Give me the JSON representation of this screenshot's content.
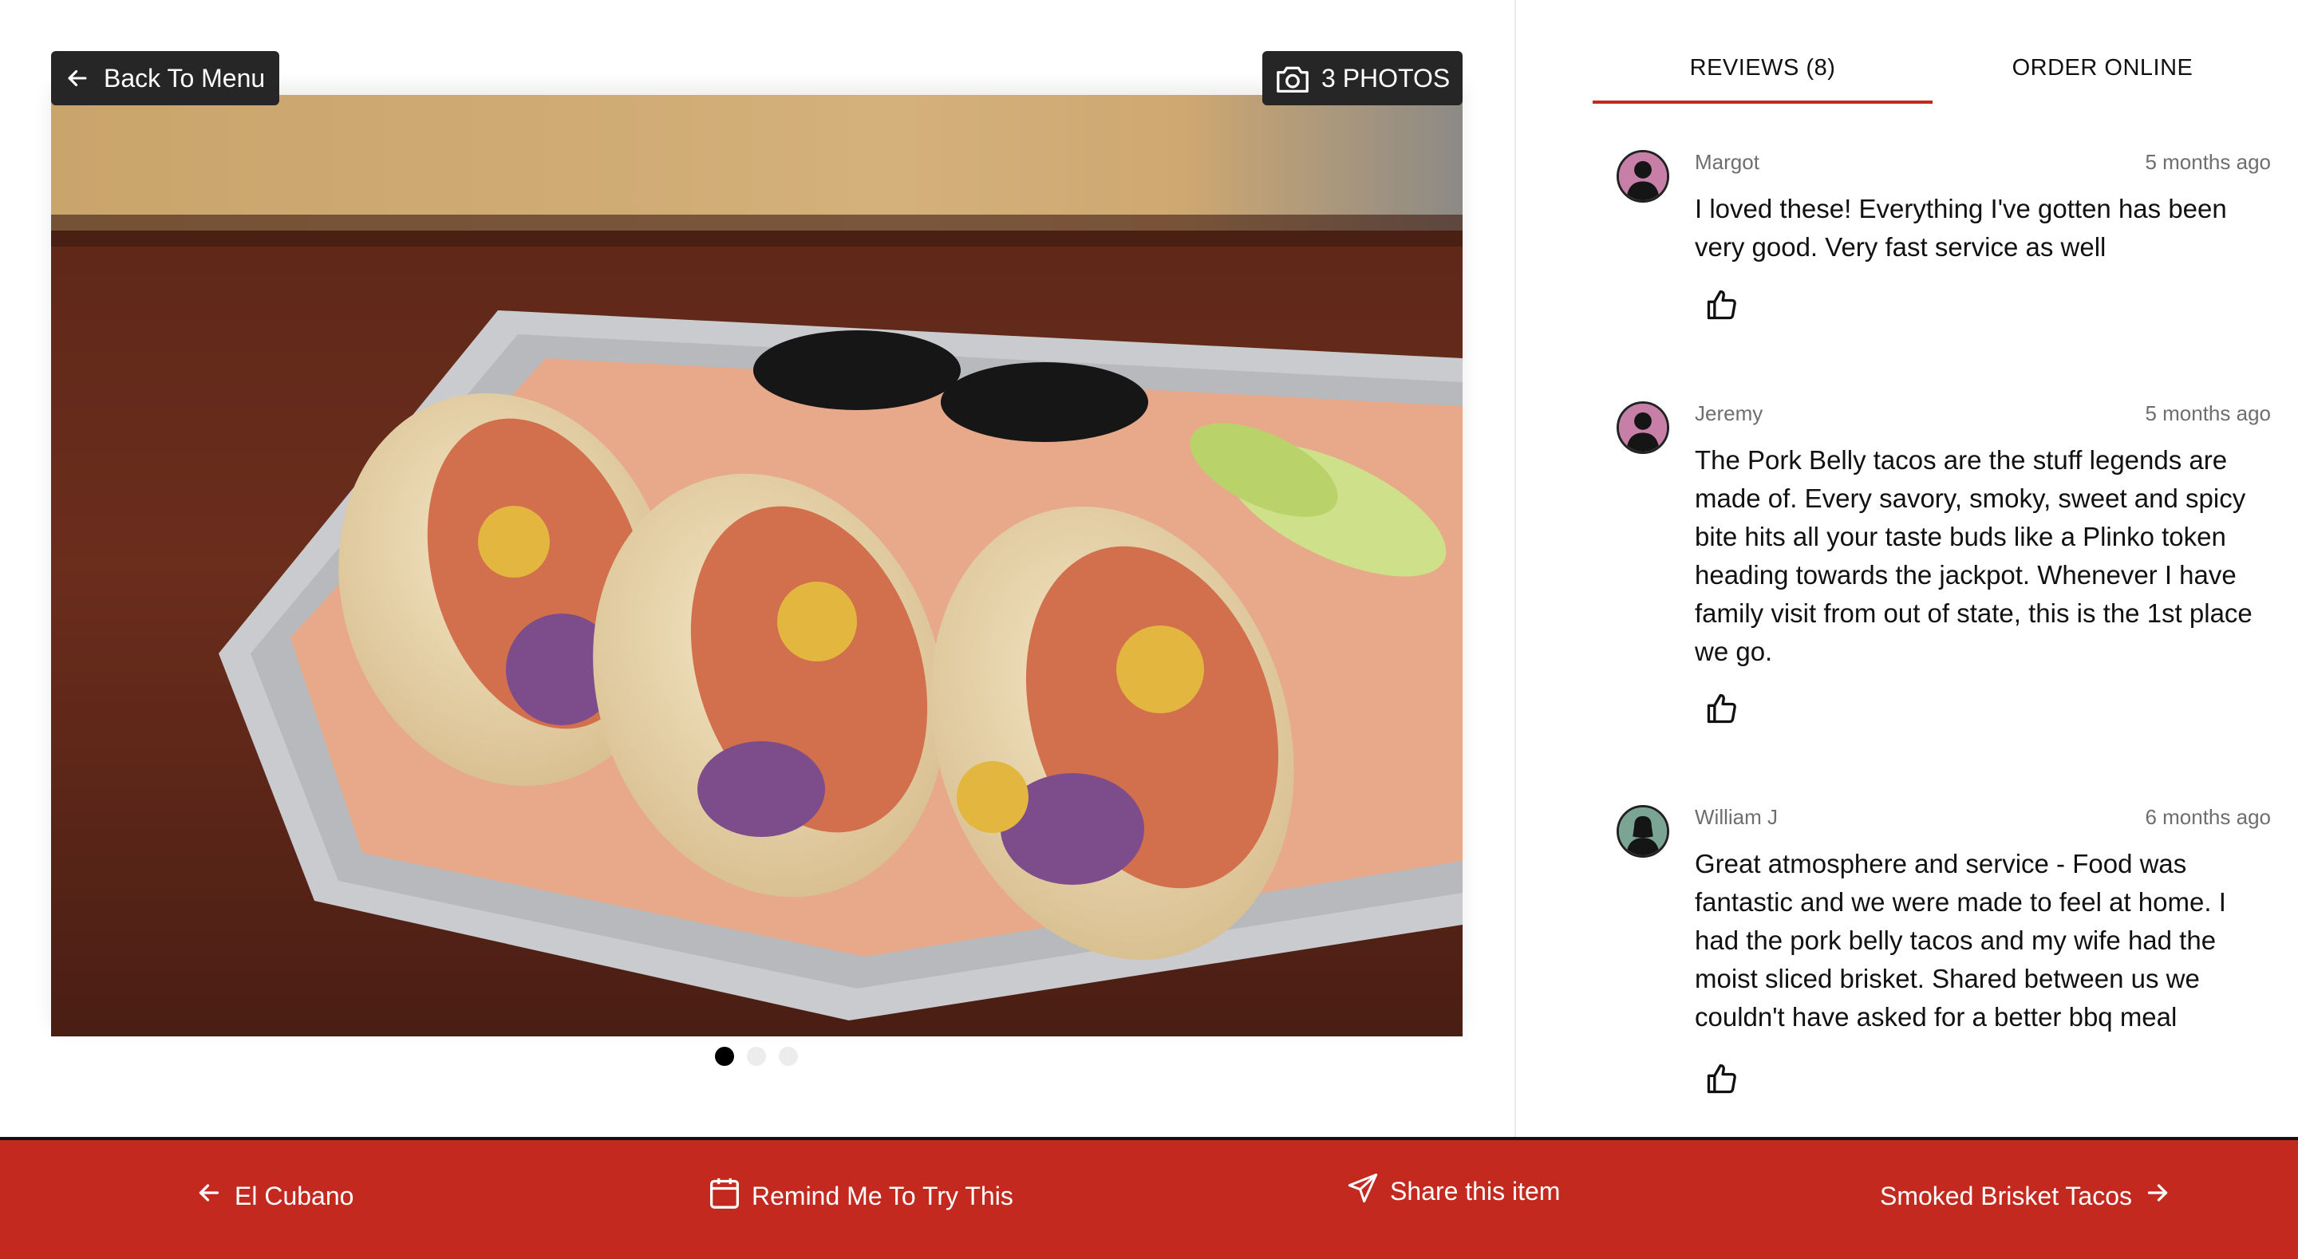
{
  "gallery": {
    "back_label": "Back To Menu",
    "photos_label": "3 PHOTOS",
    "photo_count": 3,
    "active_photo": 1
  },
  "tabs": [
    {
      "label": "REVIEWS (8)",
      "active": true
    },
    {
      "label": "ORDER ONLINE",
      "active": false
    }
  ],
  "reviews": [
    {
      "name": "Margot",
      "time": "5 months ago",
      "text": "I loved these! Everything I've gotten has been very good. Very fast service as well",
      "avatar_color": "#c77fa8"
    },
    {
      "name": "Jeremy",
      "time": "5 months ago",
      "text": "The Pork Belly tacos are the stuff legends are made of. Every savory, smoky, sweet and spicy bite hits all your taste buds like a Plinko token heading towards the jackpot. Whenever I have family visit from out of state, this is the 1st place we go.",
      "avatar_color": "#c77fa8"
    },
    {
      "name": "William J",
      "time": "6 months ago",
      "text": "Great atmosphere and service - Food was fantastic and we were made to feel at home. I had the pork belly tacos and my wife had the moist sliced brisket. Shared between us we couldn't have asked for a better bbq meal",
      "avatar_color": "#7aa595"
    }
  ],
  "footer": {
    "prev_label": "El Cubano",
    "remind_label": "Remind Me To Try This",
    "share_label": "Share this item",
    "next_label": "Smoked Brisket Tacos"
  },
  "colors": {
    "accent": "#c4291f",
    "button_bg": "#262626"
  },
  "icons": [
    "arrow-left-icon",
    "camera-icon",
    "thumbs-up-icon",
    "calendar-icon",
    "send-icon",
    "arrow-right-icon"
  ]
}
